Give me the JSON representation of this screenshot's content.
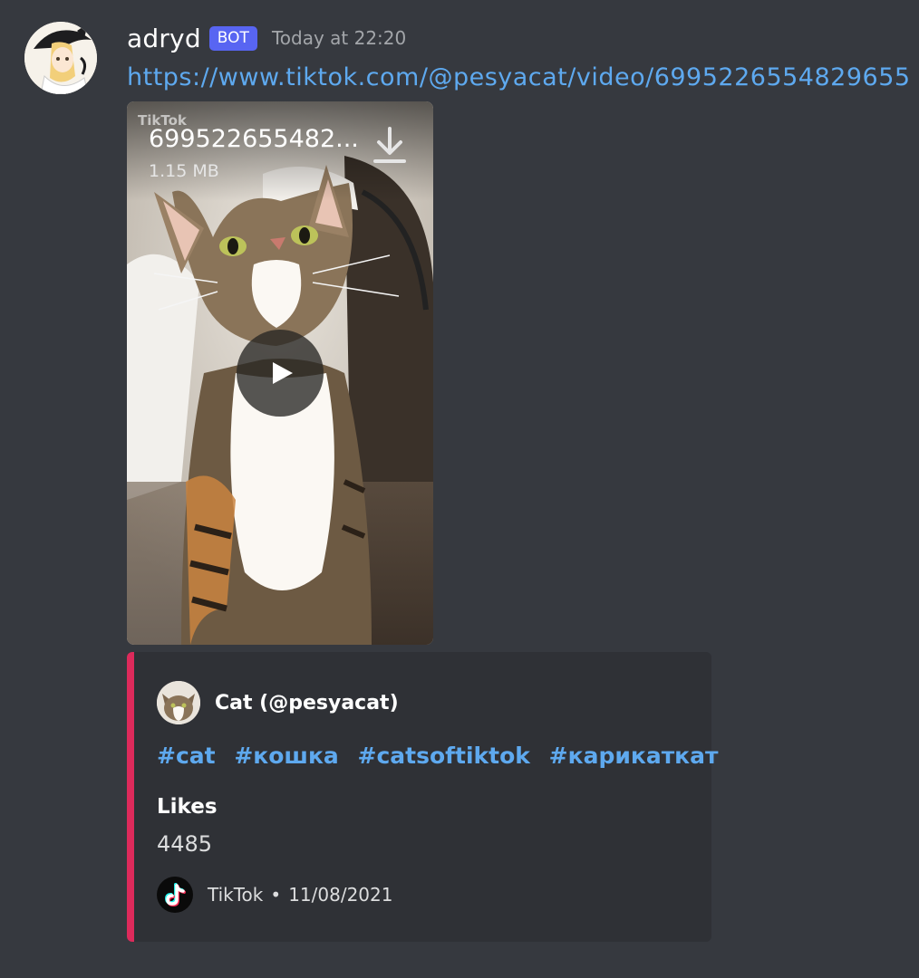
{
  "message": {
    "username": "adryd",
    "bot_tag": "BOT",
    "timestamp": "Today at 22:20",
    "link_text": "https://www.tiktok.com/@pesyacat/video/6995226554829655"
  },
  "attachment": {
    "watermark": "TikTok",
    "file_name": "699522655482...",
    "file_size": "1.15 MB"
  },
  "embed": {
    "accent_color": "#dd2a5b",
    "author_name": "Cat (@pesyacat)",
    "tags": [
      "#cat",
      "#кошка",
      "#catsoftiktok",
      "#карикаткат"
    ],
    "field_name": "Likes",
    "field_value": "4485",
    "footer_provider": "TikTok",
    "footer_separator": "•",
    "footer_date": "11/08/2021"
  },
  "colors": {
    "background": "#36393f",
    "embed_background": "#2f3136",
    "link": "#5ea9ef",
    "bot_tag": "#5865f2"
  },
  "icons": {
    "download": "download-icon",
    "play": "play-icon",
    "footer": "tiktok-logo-icon"
  }
}
